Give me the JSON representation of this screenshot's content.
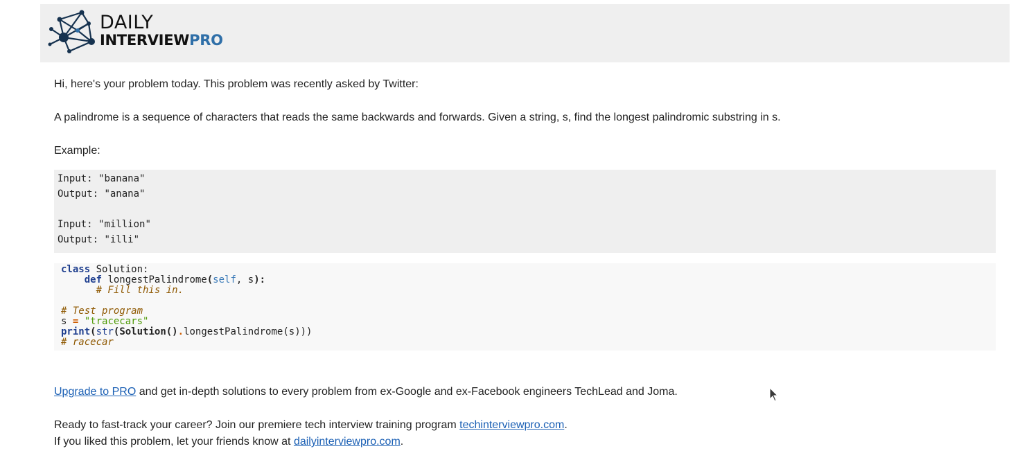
{
  "header": {
    "logo_line1": "DAILY",
    "logo_line2_main": "INTERVIEW",
    "logo_line2_accent": "PRO",
    "brand_color": "#2f6fa8"
  },
  "intro": "Hi, here's your problem today. This problem was recently asked by Twitter:",
  "problem": "A palindrome is a sequence of characters that reads the same backwards and forwards. Given a string, s, find the longest palindromic substring in s.",
  "example_label": "Example:",
  "examples": [
    {
      "input_label": "Input: ",
      "input": "\"banana\"",
      "output_label": "Output: ",
      "output": "\"anana\""
    },
    {
      "input_label": "Input: ",
      "input": "\"million\"",
      "output_label": "Output: ",
      "output": "\"illi\""
    }
  ],
  "code": {
    "kw_class": "class",
    "class_name": " Solution:",
    "kw_def": "def",
    "method_name": " longestPalindrome",
    "paren_open": "(",
    "param_self": "self",
    "param_rest": ", s",
    "paren_close": "):",
    "fill_comment": "# Fill this in.",
    "test_comment": "# Test program",
    "assign_var": "s ",
    "assign_op": "=",
    "assign_str": " \"tracecars\"",
    "print_kw": "print",
    "str_kw": "str",
    "print_rest_1": "(Solution()",
    "dot": ".",
    "print_rest_2": "longestPalindrome(s)))",
    "result_comment": "# racecar"
  },
  "upgrade": {
    "link": "Upgrade to PRO",
    "rest": " and get in-depth solutions to every problem from ex-Google and ex-Facebook engineers TechLead and Joma."
  },
  "career": {
    "text": "Ready to fast-track your career? Join our premiere tech interview training program ",
    "link": "techinterviewpro.com",
    "end": "."
  },
  "share": {
    "text": "If you liked this problem, let your friends know at ",
    "link": "dailyinterviewpro.com",
    "end": "."
  }
}
